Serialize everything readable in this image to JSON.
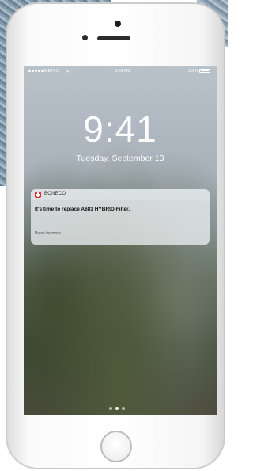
{
  "status_bar": {
    "carrier": "SKETCH",
    "time": "9:41 AM",
    "battery_percent": "100%",
    "signal_icon": "signal-dots-icon",
    "wifi_icon": "wifi-icon",
    "battery_icon": "battery-icon"
  },
  "lock_screen": {
    "time": "9:41",
    "date": "Tuesday, September 13"
  },
  "notification": {
    "app_name": "BONECO",
    "app_icon": "boneco-logo-icon",
    "app_icon_color": "#e0282d",
    "message": "It's time to replace A681 HYBRID-Filter.",
    "action_hint": "Press for more"
  },
  "page_indicator": {
    "count": 3,
    "active_index": 1
  }
}
